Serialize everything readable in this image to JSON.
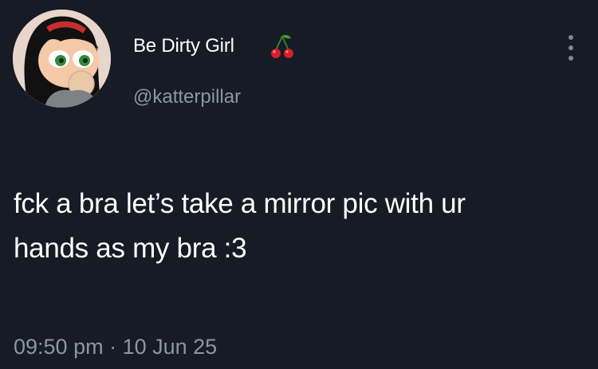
{
  "tweet": {
    "display_name": "Be Dirty Girl",
    "name_emoji": "cherries-icon",
    "handle": "@katterpillar",
    "text_line1": "fck a bra let’s take a mirror pic with ur",
    "text_line2": "hands as my bra :3",
    "time": "09:50 pm",
    "separator": " · ",
    "date": "10 Jun 25"
  },
  "colors": {
    "background": "#161b25",
    "primary_text": "#ffffff",
    "secondary_text": "#8b97a5"
  },
  "icons": {
    "more": "more-vertical-icon",
    "avatar": "cartoon-girl-avatar"
  }
}
